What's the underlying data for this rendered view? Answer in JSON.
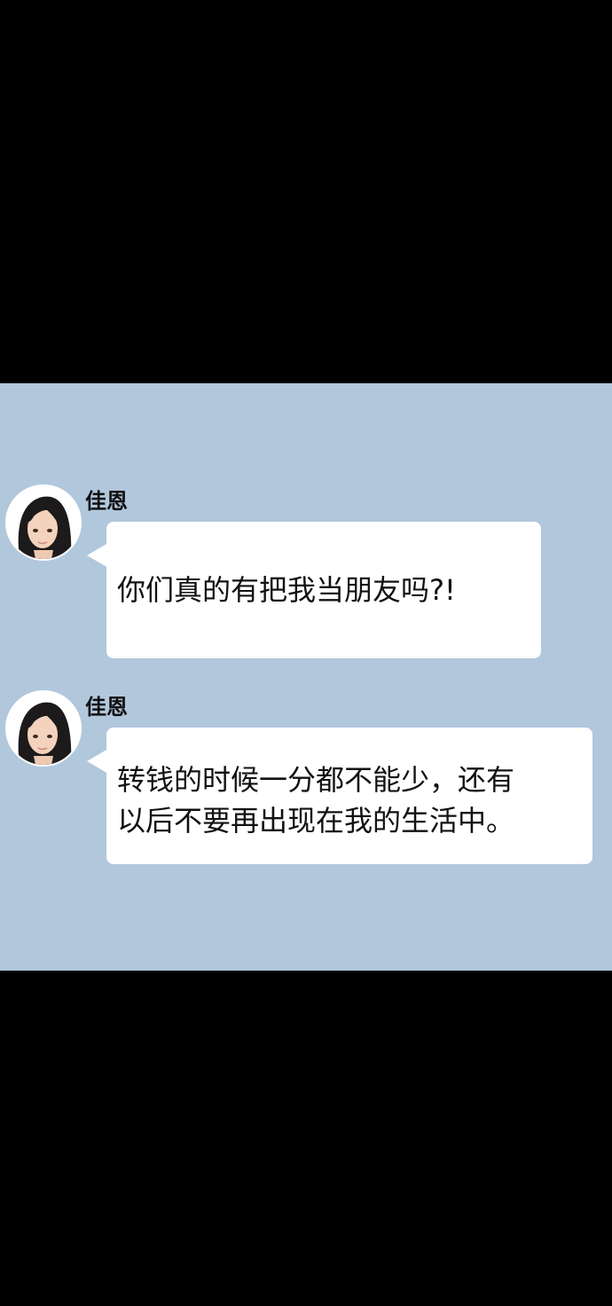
{
  "colors": {
    "background": "#000000",
    "chat_panel": "#b1c7dc",
    "bubble": "#ffffff",
    "text": "#111111"
  },
  "messages": [
    {
      "sender": "佳恩",
      "avatar_icon": "woman-avatar-icon",
      "lines": [
        "你们真的有把我当朋友吗?!"
      ]
    },
    {
      "sender": "佳恩",
      "avatar_icon": "woman-avatar-icon",
      "lines": [
        "转钱的时候一分都不能少，还有",
        "以后不要再出现在我的生活中。"
      ]
    }
  ]
}
